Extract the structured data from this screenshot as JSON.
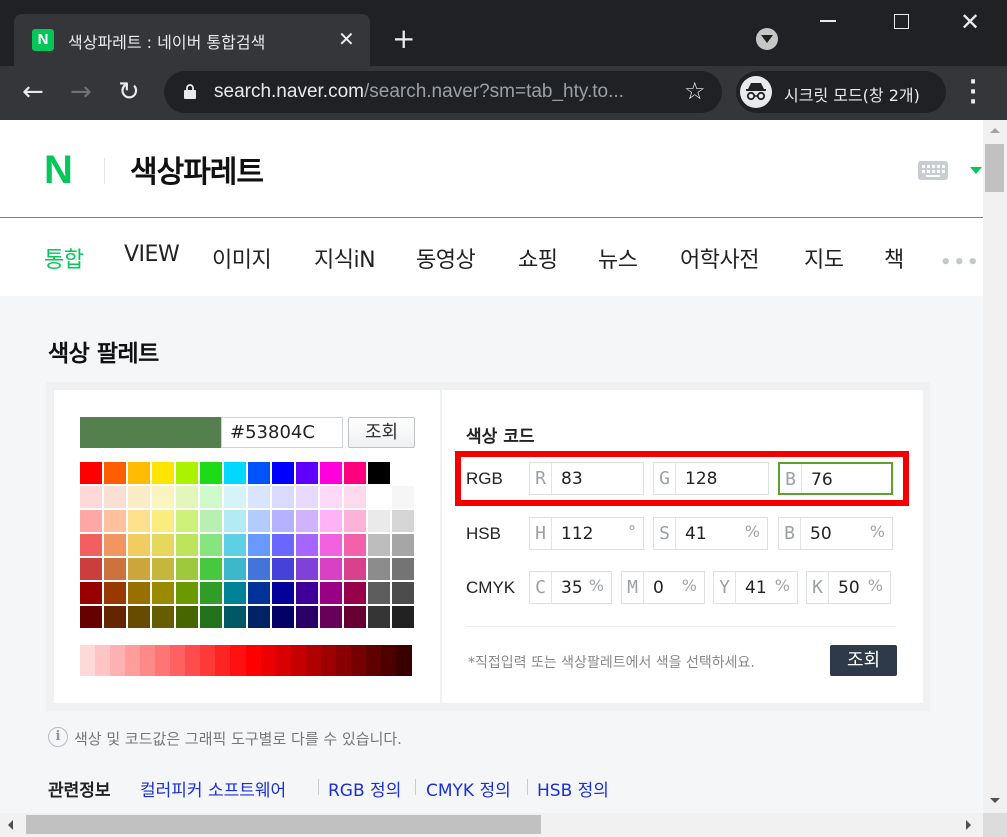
{
  "browser": {
    "tab_title": "색상파레트 : 네이버 통합검색",
    "tab_favicon": "N",
    "url_host": "search.naver.com",
    "url_path": "/search.naver?sm=tab_hty.to...",
    "incognito_label": "시크릿 모드(창 2개)"
  },
  "header": {
    "logo": "N",
    "query": "색상파레트"
  },
  "nav_tabs": [
    "통합",
    "VIEW",
    "이미지",
    "지식iN",
    "동영상",
    "쇼핑",
    "뉴스",
    "어학사전",
    "지도",
    "책"
  ],
  "nav_more": "•••",
  "palette": {
    "title": "색상 팔레트",
    "preview_color": "#53804C",
    "hex_value": "#53804C",
    "lookup_label": "조회",
    "code_title": "색상 코드",
    "rgb": {
      "label": "RGB",
      "r": {
        "letter": "R",
        "value": "83"
      },
      "g": {
        "letter": "G",
        "value": "128"
      },
      "b": {
        "letter": "B",
        "value": "76"
      }
    },
    "hsb": {
      "label": "HSB",
      "h": {
        "letter": "H",
        "value": "112",
        "unit": "°"
      },
      "s": {
        "letter": "S",
        "value": "41",
        "unit": "%"
      },
      "b": {
        "letter": "B",
        "value": "50",
        "unit": "%"
      }
    },
    "cmyk": {
      "label": "CMYK",
      "c": {
        "letter": "C",
        "value": "35",
        "unit": "%"
      },
      "m": {
        "letter": "M",
        "value": "0",
        "unit": "%"
      },
      "y": {
        "letter": "Y",
        "value": "41",
        "unit": "%"
      },
      "k": {
        "letter": "K",
        "value": "50",
        "unit": "%"
      }
    },
    "hint": "*직접입력 또는 색상팔레트에서 색을 선택하세요.",
    "lookup_dark_label": "조회",
    "swatch_rows": [
      [
        "#ff0000",
        "#ff5e00",
        "#ffbb00",
        "#ffe400",
        "#abf200",
        "#1ddb16",
        "#00d8ff",
        "#0054ff",
        "#0100ff",
        "#5f00ff",
        "#ff00dd",
        "#ff007f",
        "#000000"
      ],
      [
        "#ffd8d8",
        "#fae0d4",
        "#faecc5",
        "#faf4c0",
        "#e4f7ba",
        "#cefbc9",
        "#d4f4fa",
        "#d9e5ff",
        "#dad9ff",
        "#e8d9ff",
        "#ffd9fa",
        "#ffd9ec",
        "#ffffff",
        "#f6f6f6"
      ],
      [
        "#ffa7a7",
        "#ffc19e",
        "#ffe08c",
        "#faed7d",
        "#cef279",
        "#b7f0b1",
        "#b2ebf4",
        "#b2ccff",
        "#b5b2ff",
        "#d1b2ff",
        "#ffb2f5",
        "#ffb2d9",
        "#eaeaea",
        "#d5d5d5"
      ],
      [
        "#f15f5f",
        "#f29661",
        "#f2cb61",
        "#e5d85c",
        "#bce55c",
        "#86e57f",
        "#5cd1e5",
        "#6799ff",
        "#6b66ff",
        "#a566ff",
        "#f261df",
        "#f261aa",
        "#bdbdbd",
        "#a6a6a6"
      ],
      [
        "#cc3d3d",
        "#cc723d",
        "#cca63d",
        "#c4b73b",
        "#9fc93c",
        "#47c83e",
        "#3db7cc",
        "#4374d9",
        "#4641d9",
        "#8041d9",
        "#d941c5",
        "#d9418c",
        "#8c8c8c",
        "#747474"
      ],
      [
        "#980000",
        "#993800",
        "#997000",
        "#998a00",
        "#6b9900",
        "#2f9d27",
        "#008299",
        "#003399",
        "#050099",
        "#3f0099",
        "#990085",
        "#99004c",
        "#5d5d5d",
        "#4c4c4c"
      ],
      [
        "#670000",
        "#662500",
        "#664b00",
        "#665c00",
        "#476600",
        "#22741c",
        "#005766",
        "#002266",
        "#030066",
        "#2a0066",
        "#660058",
        "#660033",
        "#353535",
        "#212121"
      ]
    ]
  },
  "info_text": "색상 및 코드값은 그래픽 도구별로 다를 수 있습니다.",
  "related": {
    "label": "관련정보",
    "links": [
      "컬러피커 소프트웨어",
      "RGB 정의",
      "CMYK 정의",
      "HSB 정의"
    ]
  },
  "colors": {
    "naver_green": "#03c75a",
    "highlight_red": "#f40000",
    "selected_field_border": "#5ea22d"
  }
}
